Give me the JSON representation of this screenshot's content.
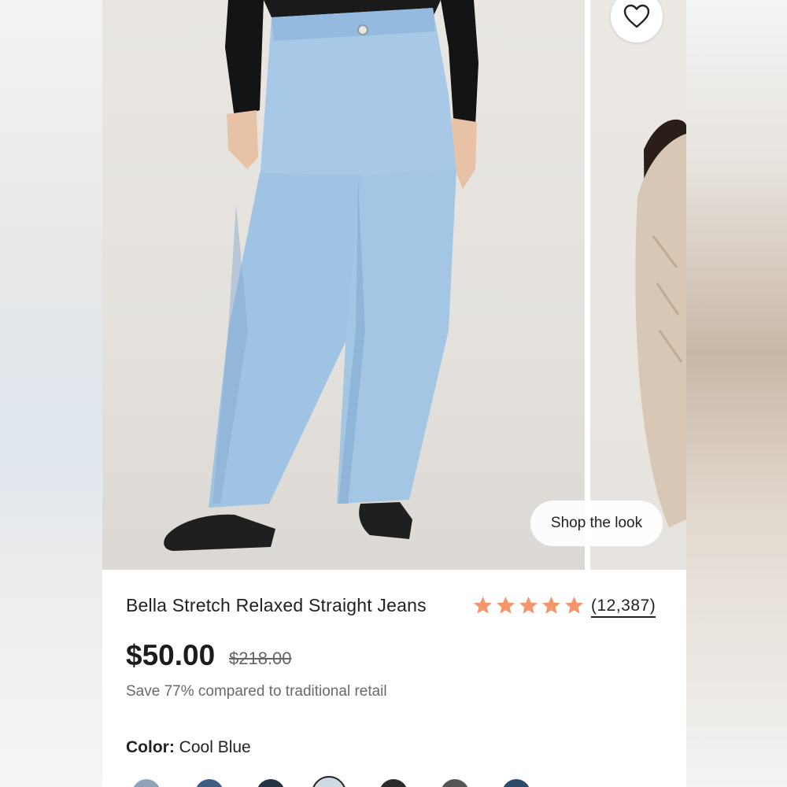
{
  "product": {
    "title": "Bella Stretch Relaxed Straight Jeans",
    "price": "$50.00",
    "original_price": "$218.00",
    "savings_text": "Save 77% compared to traditional retail",
    "rating": 5,
    "review_count": "(12,387)",
    "color_label": "Color:",
    "color_value": "Cool Blue"
  },
  "actions": {
    "shop_the_look": "Shop the look",
    "favorite_icon": "heart-icon"
  },
  "colors": {
    "star": "#F4956A",
    "swatches": [
      "#8fa3b8",
      "#3f5d82",
      "#233445",
      "#cfd9e4",
      "#2b2b2b",
      "#555555",
      "#2d4a6b"
    ]
  }
}
